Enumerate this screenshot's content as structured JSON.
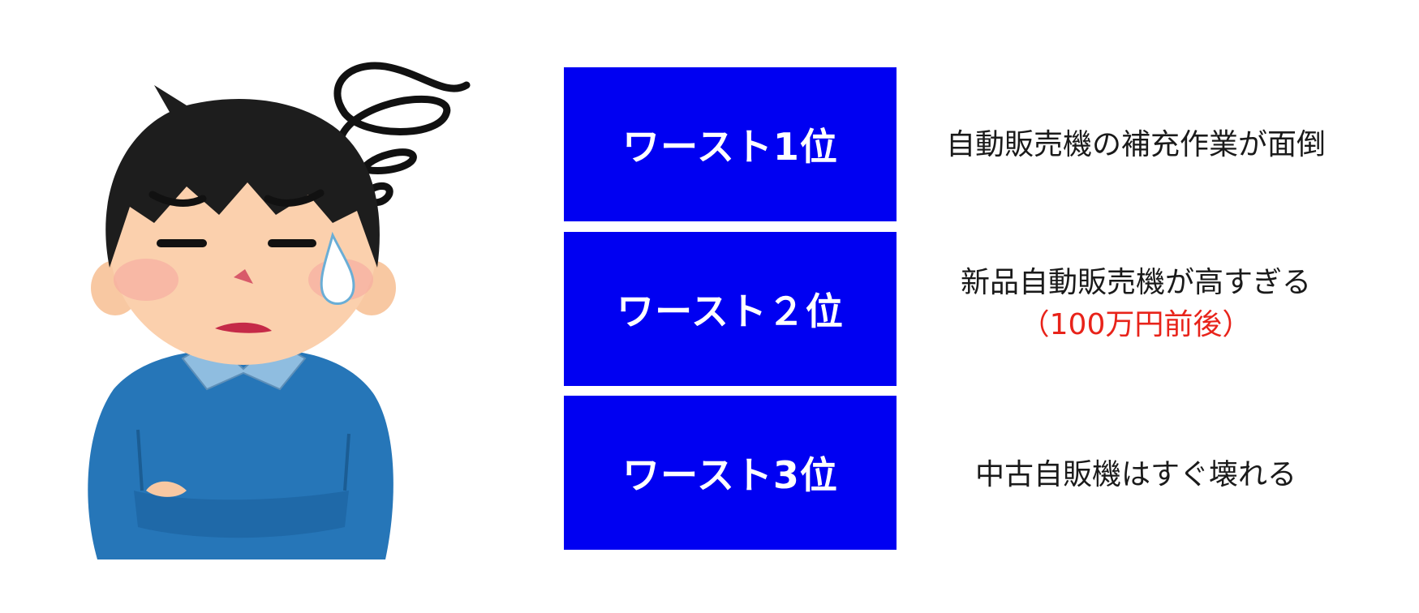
{
  "ranks": [
    {
      "label": "ワースト1位",
      "reason": "自動販売機の補充作業が面倒",
      "note": ""
    },
    {
      "label": "ワースト２位",
      "reason": "新品自動販売機が高すぎる",
      "note": "（100万円前後）"
    },
    {
      "label": "ワースト3位",
      "reason": "中古自販機はすぐ壊れる",
      "note": ""
    }
  ],
  "colors": {
    "rank_box_bg": "#0000f2",
    "rank_box_text": "#ffffff",
    "reason_text": "#1a1a1a",
    "note_text": "#e8231a"
  },
  "illustration": {
    "icon": "troubled-man-icon",
    "worry_icon": "worry-scribble-icon",
    "sweat_icon": "sweat-drop-icon"
  }
}
